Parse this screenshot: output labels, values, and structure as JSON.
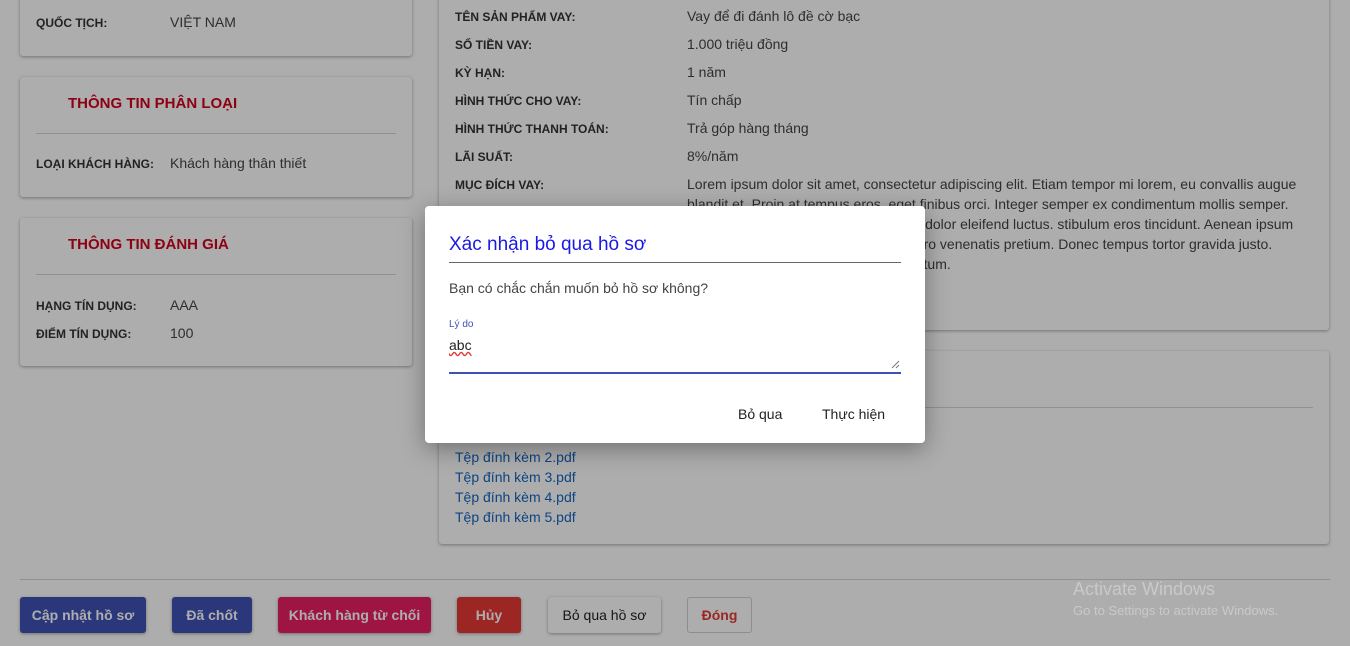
{
  "left_cards": {
    "personal": {
      "nationality_label": "QUỐC TỊCH:",
      "nationality_value": "VIỆT NAM"
    },
    "classification": {
      "title": "THÔNG TIN PHÂN LOẠI",
      "customer_type_label": "LOẠI KHÁCH HÀNG:",
      "customer_type_value": "Khách hàng thân thiết"
    },
    "evaluation": {
      "title": "THÔNG TIN ĐÁNH GIÁ",
      "credit_rank_label": "HẠNG TÍN DỤNG:",
      "credit_rank_value": "AAA",
      "credit_score_label": "ĐIỂM TÍN DỤNG:",
      "credit_score_value": "100"
    }
  },
  "loan_info": [
    {
      "label": "TÊN SẢN PHẨM VAY:",
      "value": "Vay để đi đánh lô đề cờ bạc"
    },
    {
      "label": "SỐ TIỀN VAY:",
      "value": "1.000 triệu đồng"
    },
    {
      "label": "KỲ HẠN:",
      "value": "1 năm"
    },
    {
      "label": "HÌNH THỨC CHO VAY:",
      "value": "Tín chấp"
    },
    {
      "label": "HÌNH THỨC THANH TOÁN:",
      "value": "Trả góp hàng tháng"
    },
    {
      "label": "LÃI SUẤT:",
      "value": "8%/năm"
    },
    {
      "label": "MỤC ĐÍCH VAY:",
      "value": "Lorem ipsum dolor sit amet, consectetur adipiscing elit. Etiam tempor mi lorem, eu convallis augue blandit et. Proin at tempus eros, eget finibus orci. Integer semper ex condimentum mollis semper. convallis. Vestibulum ultrices ipsum in dolor eleifend luctus. stibulum eros tincidunt. Aenean ipsum ante, molestie non n porta elit non libero venenatis pretium. Donec tempus tortor gravida justo. Donec porttitor orci eu facilisis elementum."
    }
  ],
  "attachments": [
    "Tệp đính kèm 2.pdf",
    "Tệp đính kèm 3.pdf",
    "Tệp đính kèm 4.pdf",
    "Tệp đính kèm 5.pdf"
  ],
  "footer_buttons": {
    "update": "Cập nhật hồ sơ",
    "closed": "Đã chốt",
    "customer_refused": "Khách hàng từ chối",
    "cancel": "Hủy",
    "skip_profile": "Bỏ qua hồ sơ",
    "close": "Đóng"
  },
  "colors": {
    "accent": "#3f51b5",
    "danger_title": "#d0021b",
    "pink": "#e91e63",
    "red": "#e53935",
    "link": "#1565c0"
  },
  "dialog": {
    "title": "Xác nhận bỏ qua hồ sơ",
    "message": "Bạn có chắc chắn muốn bỏ hồ sơ không?",
    "field_label": "Lý do",
    "field_value": "abc",
    "skip_label": "Bỏ qua",
    "confirm_label": "Thực hiện"
  },
  "watermark": {
    "title": "Activate Windows",
    "subtitle": "Go to Settings to activate Windows."
  }
}
